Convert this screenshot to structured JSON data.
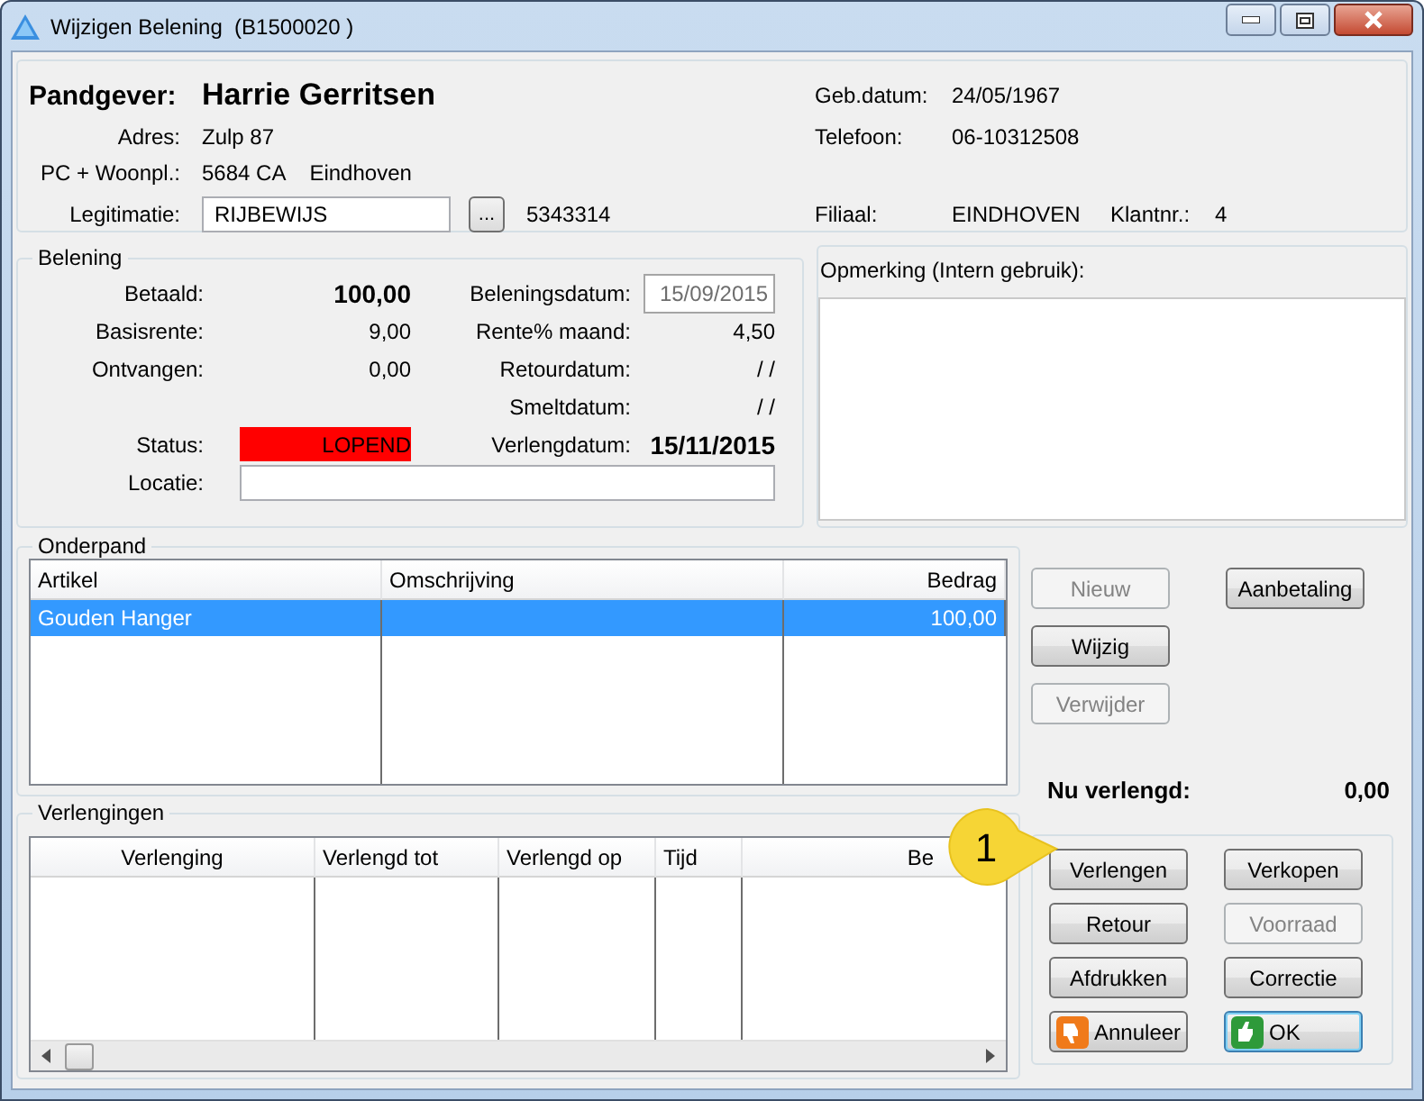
{
  "window": {
    "title": "Wijzigen Belening  (B1500020 )"
  },
  "customer": {
    "heading": "Pandgever:",
    "name": "Harrie Gerritsen",
    "address": {
      "label": "Adres:",
      "value": "Zulp 87"
    },
    "place": {
      "label": "PC + Woonpl.:",
      "postcode": "5684 CA",
      "city": "Eindhoven"
    },
    "id": {
      "label": "Legitimatie:",
      "value": "RIJBEWIJS",
      "browse": "...",
      "number": "5343314"
    },
    "details": [
      {
        "label": "Geb.datum:",
        "value": "24/05/1967"
      },
      {
        "label": "Telefoon:",
        "value": "06-10312508"
      }
    ],
    "branch": {
      "label": "Filiaal:",
      "value": "EINDHOVEN",
      "customer_label": "Klantnr.:",
      "customer_value": "4"
    }
  },
  "loan": {
    "title": "Belening",
    "rows": [
      {
        "left": {
          "label": "Betaald:",
          "value": "100,00",
          "bold": true
        },
        "right": {
          "kind": "field",
          "label": "Beleningsdatum:",
          "value": "15/09/2015",
          "disabled": true
        }
      },
      {
        "left": {
          "label": "Basisrente:",
          "value": "9,00",
          "bold": false
        },
        "right": {
          "kind": "text",
          "label": "Rente% maand:",
          "value": "4,50",
          "bold": false
        }
      },
      {
        "left": {
          "label": "Ontvangen:",
          "value": "0,00",
          "bold": false
        },
        "right": {
          "kind": "text",
          "label": "Retourdatum:",
          "value": "/ /",
          "bold": false
        }
      },
      {
        "right": {
          "kind": "text",
          "label": "Smeltdatum:",
          "value": "/ /",
          "bold": false
        }
      },
      {
        "left": {
          "label": "Status:",
          "value": "LOPEND",
          "color": "#ff0000"
        },
        "right": {
          "kind": "text",
          "label": "Verlengdatum:",
          "value": "15/11/2015",
          "bold": true
        }
      }
    ],
    "location": {
      "label": "Locatie:"
    }
  },
  "remark": {
    "label": "Opmerking (Intern gebruik):"
  },
  "items": {
    "title": "Onderpand",
    "columns": [
      {
        "label": "Artikel"
      },
      {
        "label": "Omschrijving"
      },
      {
        "label": "Bedrag"
      }
    ],
    "rows": [
      {
        "cells": [
          "Gouden Hanger",
          null,
          "100,00"
        ],
        "selected": true
      }
    ]
  },
  "item_buttons": [
    {
      "label": "Nieuw",
      "disabled": true
    },
    {
      "label": "Wijzig",
      "disabled": false
    },
    {
      "label": "Verwijder",
      "disabled": true
    }
  ],
  "payment_button": {
    "label": "Aanbetaling",
    "disabled": false
  },
  "extended_now": {
    "label": "Nu verlengd:",
    "value": "0,00"
  },
  "extensions": {
    "title": "Verlengingen",
    "columns": [
      {
        "label": "Verlenging"
      },
      {
        "label": "Verlengd tot"
      },
      {
        "label": "Verlengd op"
      },
      {
        "label": "Tijd"
      },
      {
        "label": "Be"
      }
    ]
  },
  "actions": [
    {
      "label": "Verlengen",
      "kind": "plain",
      "disabled": false,
      "default": false
    },
    {
      "label": "Verkopen",
      "kind": "plain",
      "disabled": false,
      "default": false
    },
    {
      "label": "Retour",
      "kind": "plain",
      "disabled": false,
      "default": false
    },
    {
      "label": "Voorraad",
      "kind": "plain",
      "disabled": true,
      "default": false
    },
    {
      "label": "Afdrukken",
      "kind": "plain",
      "disabled": false,
      "default": false
    },
    {
      "label": "Correctie",
      "kind": "plain",
      "disabled": false,
      "default": false
    },
    {
      "label": "Annuleer",
      "kind": "cancel",
      "disabled": false,
      "default": false
    },
    {
      "label": "OK",
      "kind": "ok",
      "disabled": false,
      "default": true
    }
  ],
  "callout": {
    "label": "1"
  }
}
